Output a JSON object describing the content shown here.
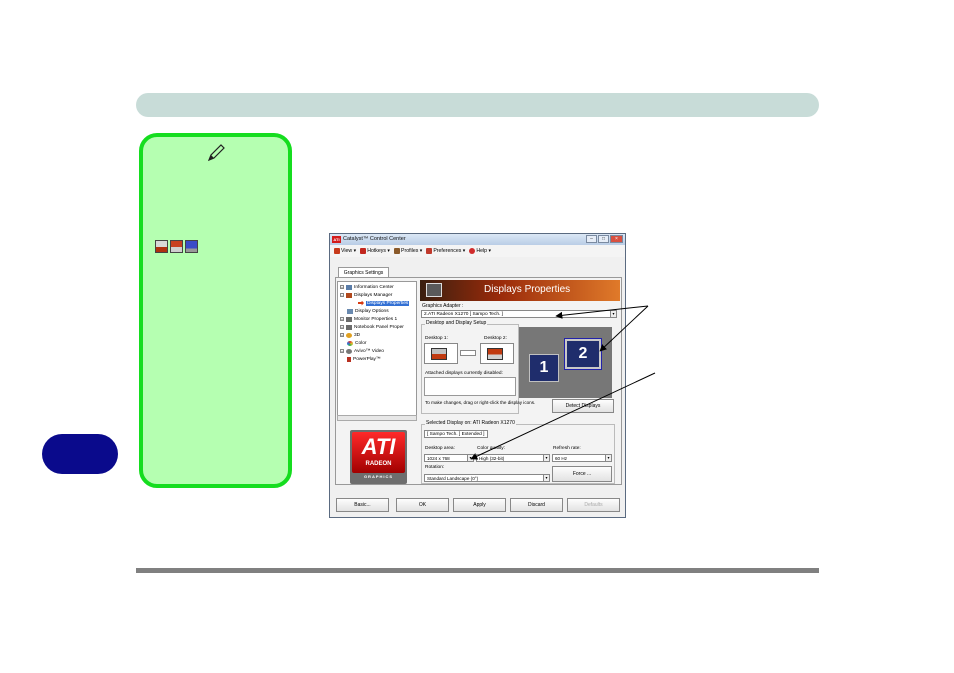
{
  "window": {
    "title": "Catalyst™ Control Center",
    "controls": {
      "minimize": "–",
      "maximize": "□",
      "close": "×"
    }
  },
  "menu": [
    {
      "label": "View ▾",
      "icon": "view-icon",
      "color": "#c73a1b"
    },
    {
      "label": "Hotkeys ▾",
      "icon": "hotkeys-icon",
      "color": "#c2271e"
    },
    {
      "label": "Profiles ▾",
      "icon": "profiles-icon",
      "color": "#8a5a2a"
    },
    {
      "label": "Preferences ▾",
      "icon": "preferences-icon",
      "color": "#c0392b"
    },
    {
      "label": "Help ▾",
      "icon": "help-icon",
      "color": "#d02b2b"
    }
  ],
  "tab": "Graphics Settings",
  "tree": [
    {
      "label": "Information Center",
      "expander": "+",
      "color": "#5a7ca8"
    },
    {
      "label": "Displays Manager",
      "expander": "–",
      "color": "#b0481d"
    },
    {
      "label": "Displays Properties",
      "expander": "",
      "color": "#d83a10",
      "selected": true
    },
    {
      "label": "Display Options",
      "expander": "",
      "color": "#6a8ab0"
    },
    {
      "label": "Monitor Properties 1",
      "expander": "+",
      "color": "#6b6b6b"
    },
    {
      "label": "Notebook Panel Proper",
      "expander": "+",
      "color": "#6b6b6b"
    },
    {
      "label": "3D",
      "expander": "+",
      "color": "#e0a020"
    },
    {
      "label": "Color",
      "expander": "",
      "color": "#3c8ae0"
    },
    {
      "label": "Avivo™ Video",
      "expander": "+",
      "color": "#777777"
    },
    {
      "label": "PowerPlay™",
      "expander": "",
      "color": "#b83020"
    }
  ],
  "logo": {
    "brand": "ATI",
    "line1": "RADEON",
    "line2": "GRAPHICS",
    "window_badge": "ATI"
  },
  "banner_title": "Displays Properties",
  "adapter": {
    "label": "Graphics Adapter :",
    "value": "2.ATI Radeon X1270 [ Sampo Tech. ]"
  },
  "setup": {
    "group_label": "Desktop and Display Setup",
    "desktop1": "Desktop 1:",
    "desktop2": "Desktop 2:",
    "disabled_label": "Attached displays currently disabled:",
    "hint": "To make changes, drag or right-click the display icons.",
    "display1": "1",
    "display2": "2",
    "detect_button": "Detect Displays"
  },
  "selected": {
    "group_label": "Selected Display on: ATI Radeon X1270",
    "tab": "[ Sampo Tech. ] Extended ]",
    "area_label": "Desktop area:",
    "area_value": "1024 x 768",
    "color_label": "Color quality:",
    "color_value": "High (32-bit)",
    "refresh_label": "Refresh rate:",
    "refresh_value": "60 Hz",
    "rotation_label": "Rotation:",
    "rotation_value": "Standard Landscape (0°)",
    "force_button": "Force ..."
  },
  "buttons": {
    "basic": "Basic...",
    "ok": "OK",
    "apply": "Apply",
    "discard": "Discard",
    "defaults": "Defaults"
  },
  "colors": {
    "note_bg": "#b5ffb1",
    "note_border": "#15dd1f",
    "header_bar": "#c8dcd8",
    "chapter_tab": "#0a0a8c"
  }
}
